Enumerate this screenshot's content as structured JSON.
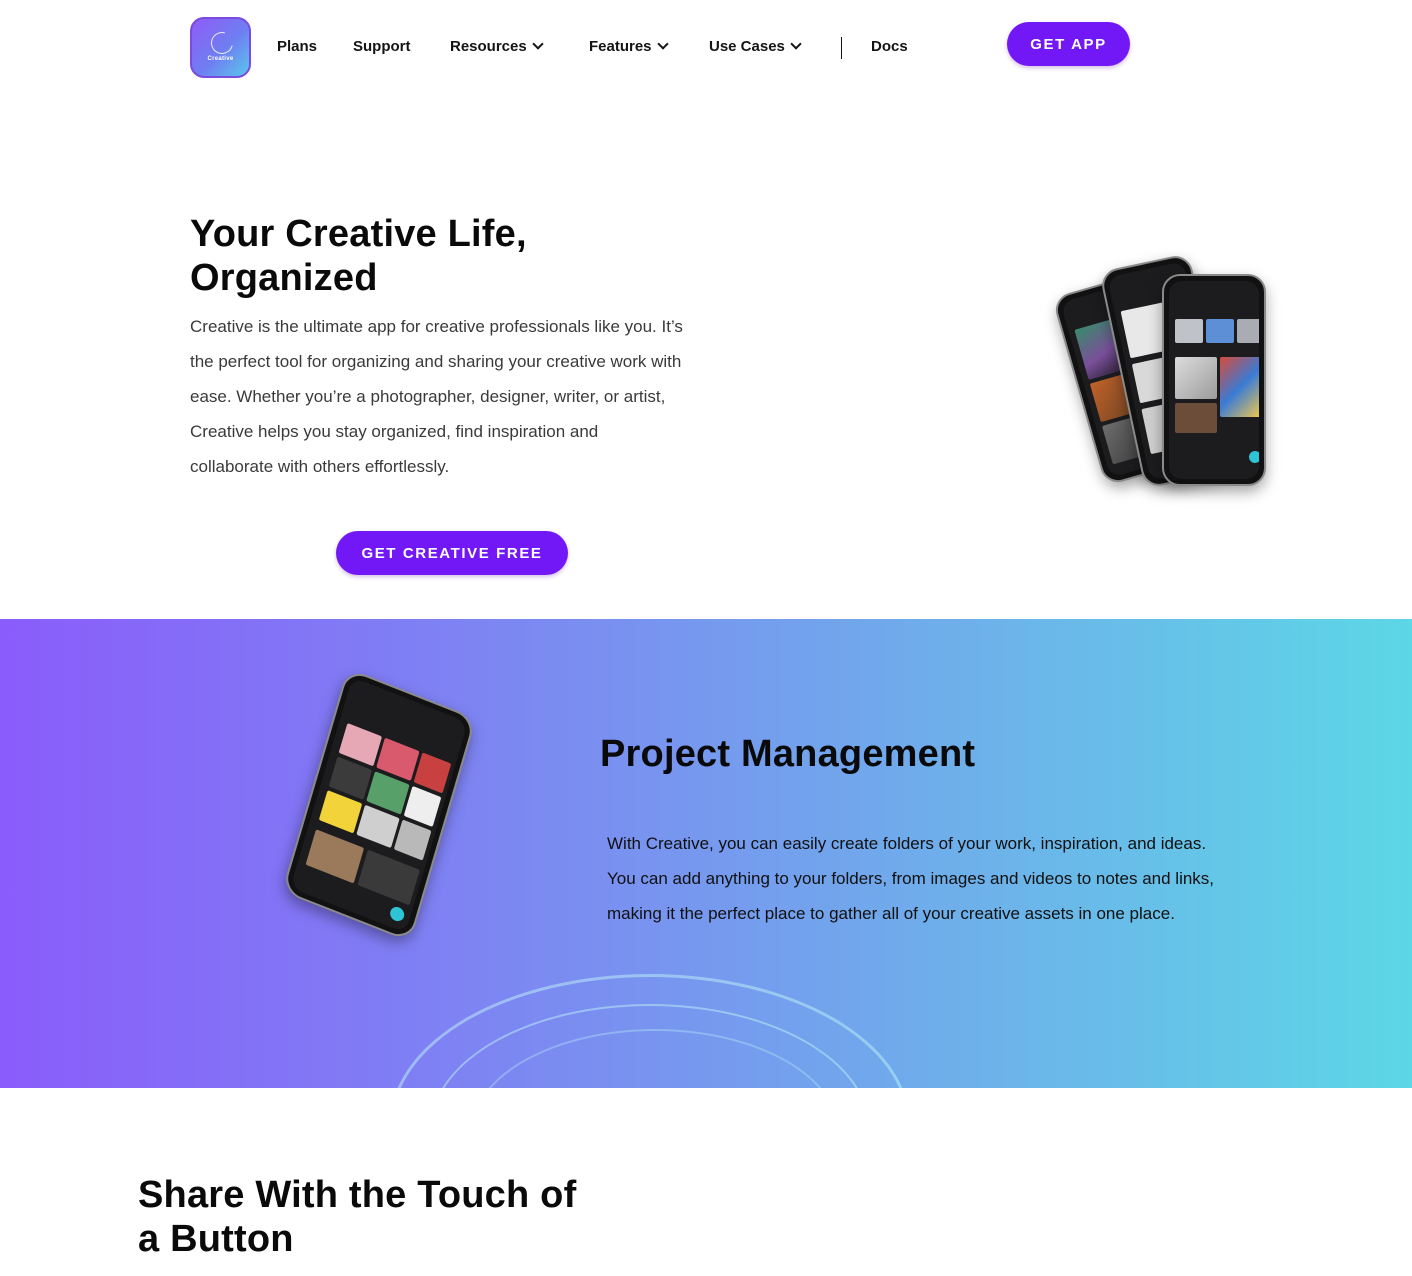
{
  "brand": {
    "logo_text": "Creative"
  },
  "nav": {
    "plans": "Plans",
    "support": "Support",
    "resources": "Resources",
    "features": "Features",
    "use_cases": "Use Cases",
    "docs": "Docs",
    "get_app": "GET APP"
  },
  "hero": {
    "title": "Your Creative Life, Organized",
    "body": "Creative is the ultimate app for creative professionals like you. It’s the perfect tool for organizing and sharing your creative work with ease. Whether you’re a photographer, designer, writer, or artist, Creative helps you stay organized, find inspiration and collaborate with others effortlessly.",
    "cta": "GET CREATIVE FREE"
  },
  "project_management": {
    "title": "Project Management",
    "body": "With Creative, you can easily create folders of your work, inspiration, and ideas. You can add anything to your folders, from images and videos to notes and links, making it the perfect place to gather all of your creative assets in one place."
  },
  "share": {
    "title": "Share With the Touch of a Button"
  },
  "colors": {
    "accent": "#7217f5",
    "gradient_start": "#8a5cfb",
    "gradient_end": "#5cd7e6"
  },
  "icons": [
    "creative-logo-icon",
    "chevron-down-icon",
    "phone-mockup-image"
  ]
}
